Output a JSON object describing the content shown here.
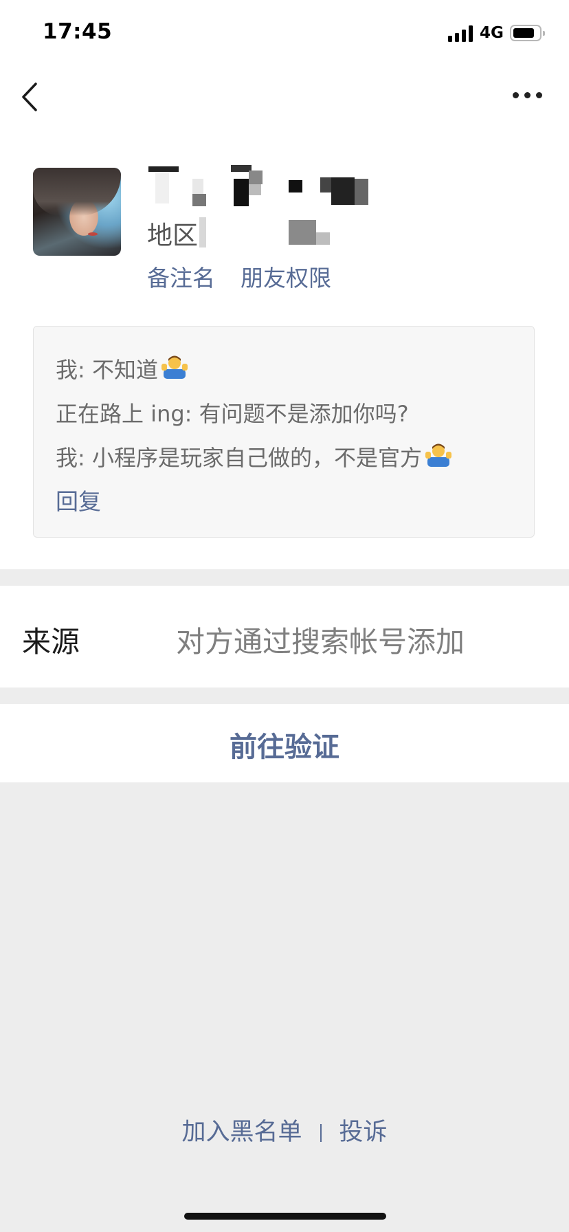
{
  "status_bar": {
    "time": "17:45",
    "network": "4G",
    "icons": [
      "signal-icon",
      "battery-icon"
    ]
  },
  "nav": {
    "back_icon": "chevron-left-icon",
    "more_icon": "ellipsis-icon"
  },
  "profile": {
    "avatar": "avatar",
    "region_label": "地区",
    "remark_link": "备注名",
    "permission_link": "朋友权限"
  },
  "messages": {
    "items": [
      {
        "text": "我: 不知道",
        "emoji": "person-shrugging-emoji"
      },
      {
        "text": "正在路上 ing: 有问题不是添加你吗?",
        "emoji": ""
      },
      {
        "text": "我: 小程序是玩家自己做的，不是官方",
        "emoji": "person-shrugging-emoji"
      }
    ],
    "reply_label": "回复"
  },
  "source": {
    "label": "来源",
    "value": "对方通过搜索帐号添加"
  },
  "verify_label": "前往验证",
  "footer": {
    "blacklist_label": "加入黑名单",
    "complain_label": "投诉"
  },
  "colors": {
    "link": "#576b95",
    "background": "#ededed"
  }
}
